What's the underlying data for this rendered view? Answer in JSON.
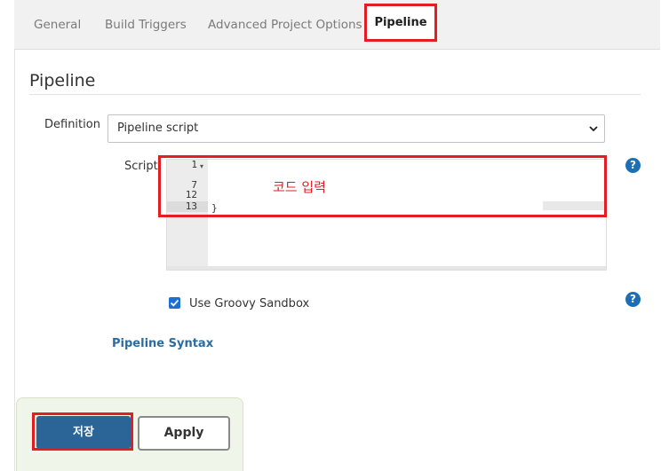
{
  "tabs": [
    {
      "label": "General"
    },
    {
      "label": "Build Triggers"
    },
    {
      "label": "Advanced Project Options"
    },
    {
      "label": "Pipeline",
      "active": true
    }
  ],
  "section": {
    "title": "Pipeline"
  },
  "definition": {
    "label": "Definition",
    "selected": "Pipeline script"
  },
  "script": {
    "label": "Script",
    "line_numbers": [
      "1",
      "7",
      "12",
      "13"
    ],
    "annotation": "코드 입력"
  },
  "sandbox": {
    "label": "Use Groovy Sandbox",
    "checked": true
  },
  "links": {
    "pipeline_syntax": "Pipeline Syntax"
  },
  "buttons": {
    "save": "저장",
    "apply": "Apply"
  },
  "help": {
    "icon_text": "?"
  },
  "colors": {
    "accent": "#2b6597",
    "highlight": "#e41c23",
    "link": "#2c6ba0"
  }
}
